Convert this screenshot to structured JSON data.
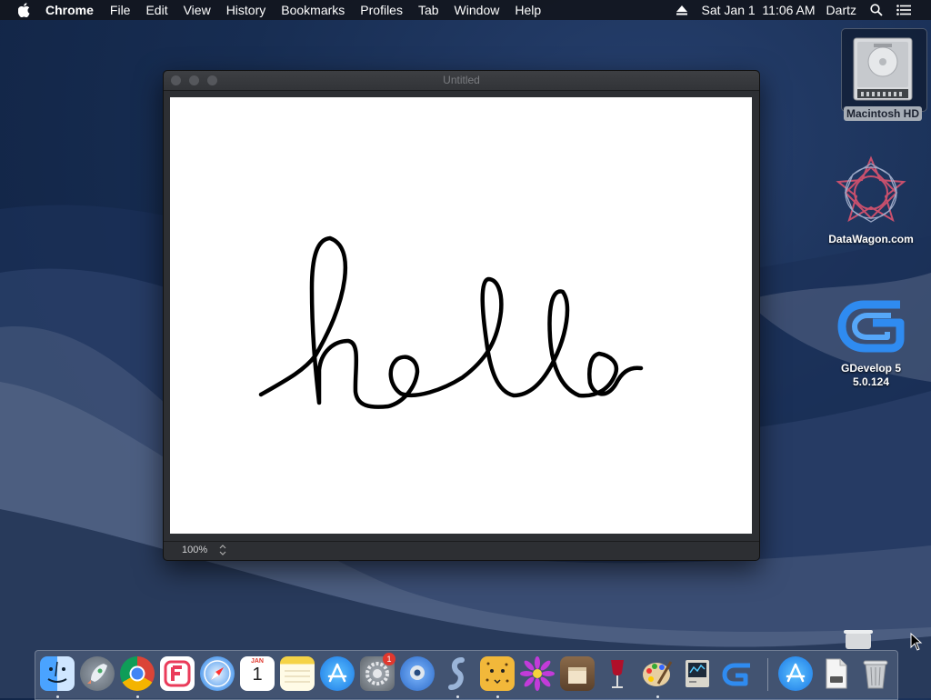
{
  "menubar": {
    "app_name": "Chrome",
    "menus": [
      "File",
      "Edit",
      "View",
      "History",
      "Bookmarks",
      "Profiles",
      "Tab",
      "Window",
      "Help"
    ],
    "clock": "Sat Jan 1  11:06 AM",
    "user": "Dartz"
  },
  "desktop": {
    "icons": [
      {
        "label": "Macintosh HD",
        "icon": "hard-drive-icon"
      },
      {
        "label": "DataWagon.com",
        "icon": "datawagon-icon"
      },
      {
        "label": "GDevelop 5\n5.0.124",
        "line1": "GDevelop 5",
        "line2": "5.0.124",
        "icon": "gdevelop-icon"
      }
    ]
  },
  "window": {
    "title": "Untitled",
    "canvas_text_handwritten": "hello",
    "zoom": "100%"
  },
  "dock": {
    "apps": [
      "Finder",
      "Launchpad",
      "Google Chrome",
      "Flashcards",
      "Safari",
      "Calendar",
      "Notes",
      "App Store",
      "System Preferences",
      "Screen Sharing",
      "Script Editor",
      "Cheetah",
      "Flower",
      "Bookmarks app",
      "Wine",
      "Paintbrush",
      "Activity",
      "GDevelop"
    ],
    "calendar_month": "JAN",
    "calendar_day": "1",
    "prefs_badge": "1"
  },
  "colors": {
    "menubar_bg": "#12161e",
    "window_bg": "#2d2f33",
    "accent_blue": "#2f8bf0",
    "badge_red": "#e0382e"
  }
}
